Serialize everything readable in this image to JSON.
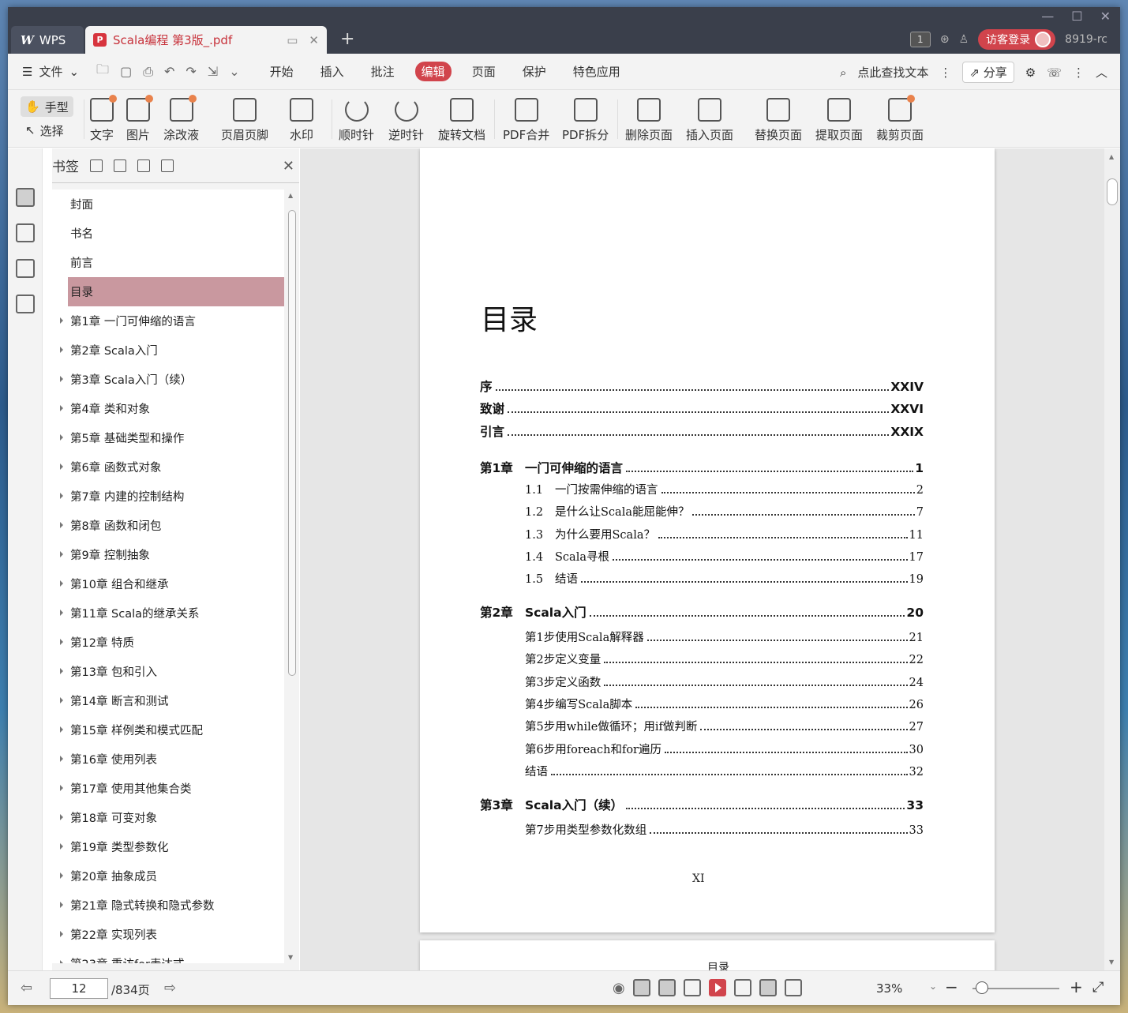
{
  "titlebar": {
    "wps_label": "WPS",
    "doc_tab": "Scala编程 第3版_.pdf",
    "badge": "1",
    "login": "访客登录",
    "user": "8919-rc"
  },
  "menubar": {
    "file": "文件",
    "tabs": [
      "开始",
      "插入",
      "批注",
      "编辑",
      "页面",
      "保护",
      "特色应用"
    ],
    "active_tab": "编辑",
    "search": "点此查找文本",
    "share": "分享"
  },
  "toolbar": {
    "mode_hand": "手型",
    "mode_select": "选择",
    "tools": [
      "文字",
      "图片",
      "涂改液",
      "页眉页脚",
      "水印",
      "顺时针",
      "逆时针",
      "旋转文档",
      "PDF合并",
      "PDF拆分",
      "删除页面",
      "插入页面",
      "替换页面",
      "提取页面",
      "裁剪页面"
    ]
  },
  "bookmarks": {
    "title": "书签",
    "items": [
      {
        "label": "封面",
        "expandable": false
      },
      {
        "label": "书名",
        "expandable": false
      },
      {
        "label": "前言",
        "expandable": false
      },
      {
        "label": "目录",
        "expandable": false,
        "active": true
      },
      {
        "label": "第1章 一门可伸缩的语言",
        "expandable": true
      },
      {
        "label": "第2章 Scala入门",
        "expandable": true
      },
      {
        "label": "第3章 Scala入门（续）",
        "expandable": true
      },
      {
        "label": "第4章 类和对象",
        "expandable": true
      },
      {
        "label": "第5章 基础类型和操作",
        "expandable": true
      },
      {
        "label": "第6章 函数式对象",
        "expandable": true
      },
      {
        "label": "第7章 内建的控制结构",
        "expandable": true
      },
      {
        "label": "第8章 函数和闭包",
        "expandable": true
      },
      {
        "label": "第9章 控制抽象",
        "expandable": true
      },
      {
        "label": "第10章 组合和继承",
        "expandable": true
      },
      {
        "label": "第11章 Scala的继承关系",
        "expandable": true
      },
      {
        "label": "第12章 特质",
        "expandable": true
      },
      {
        "label": "第13章 包和引入",
        "expandable": true
      },
      {
        "label": "第14章 断言和测试",
        "expandable": true
      },
      {
        "label": "第15章 样例类和模式匹配",
        "expandable": true
      },
      {
        "label": "第16章 使用列表",
        "expandable": true
      },
      {
        "label": "第17章 使用其他集合类",
        "expandable": true
      },
      {
        "label": "第18章 可变对象",
        "expandable": true
      },
      {
        "label": "第19章 类型参数化",
        "expandable": true
      },
      {
        "label": "第20章 抽象成员",
        "expandable": true
      },
      {
        "label": "第21章 隐式转换和隐式参数",
        "expandable": true
      },
      {
        "label": "第22章 实现列表",
        "expandable": true
      },
      {
        "label": "第23章 重访for表达式",
        "expandable": true
      }
    ]
  },
  "page": {
    "title": "目录",
    "toc": [
      {
        "kind": "front",
        "label": "序",
        "page": "XXIV"
      },
      {
        "kind": "front",
        "label": "致谢",
        "page": "XXVI"
      },
      {
        "kind": "front",
        "label": "引言",
        "page": "XXIX"
      },
      {
        "kind": "chapter",
        "chap": "第1章",
        "label": "一门可伸缩的语言",
        "page": "1"
      },
      {
        "kind": "sub",
        "num": "1.1",
        "label": "一门按需伸缩的语言",
        "page": "2"
      },
      {
        "kind": "sub",
        "num": "1.2",
        "label": "是什么让Scala能屈能伸？",
        "page": "7"
      },
      {
        "kind": "sub",
        "num": "1.3",
        "label": "为什么要用Scala？",
        "page": "11"
      },
      {
        "kind": "sub",
        "num": "1.4",
        "label": "Scala寻根",
        "page": "17"
      },
      {
        "kind": "sub",
        "num": "1.5",
        "label": "结语",
        "page": "19"
      },
      {
        "kind": "chapter",
        "chap": "第2章",
        "label": "Scala入门",
        "page": "20"
      },
      {
        "kind": "sub",
        "num": "第1步",
        "label": "使用Scala解释器",
        "page": "21"
      },
      {
        "kind": "sub",
        "num": "第2步",
        "label": "定义变量",
        "page": "22"
      },
      {
        "kind": "sub",
        "num": "第3步",
        "label": "定义函数",
        "page": "24"
      },
      {
        "kind": "sub",
        "num": "第4步",
        "label": "编写Scala脚本",
        "page": "26"
      },
      {
        "kind": "sub",
        "num": "第5步",
        "label": "用while做循环；用if做判断",
        "page": "27"
      },
      {
        "kind": "sub",
        "num": "第6步",
        "label": "用foreach和for遍历",
        "page": "30"
      },
      {
        "kind": "sub",
        "num": "",
        "label": "结语",
        "page": "32"
      },
      {
        "kind": "chapter",
        "chap": "第3章",
        "label": "Scala入门（续）",
        "page": "33"
      },
      {
        "kind": "sub",
        "num": "第7步",
        "label": "用类型参数化数组",
        "page": "33"
      }
    ],
    "page_number": "XI",
    "next_header": "目录"
  },
  "status": {
    "current_page": "12",
    "total": "/834页",
    "zoom": "33%"
  }
}
